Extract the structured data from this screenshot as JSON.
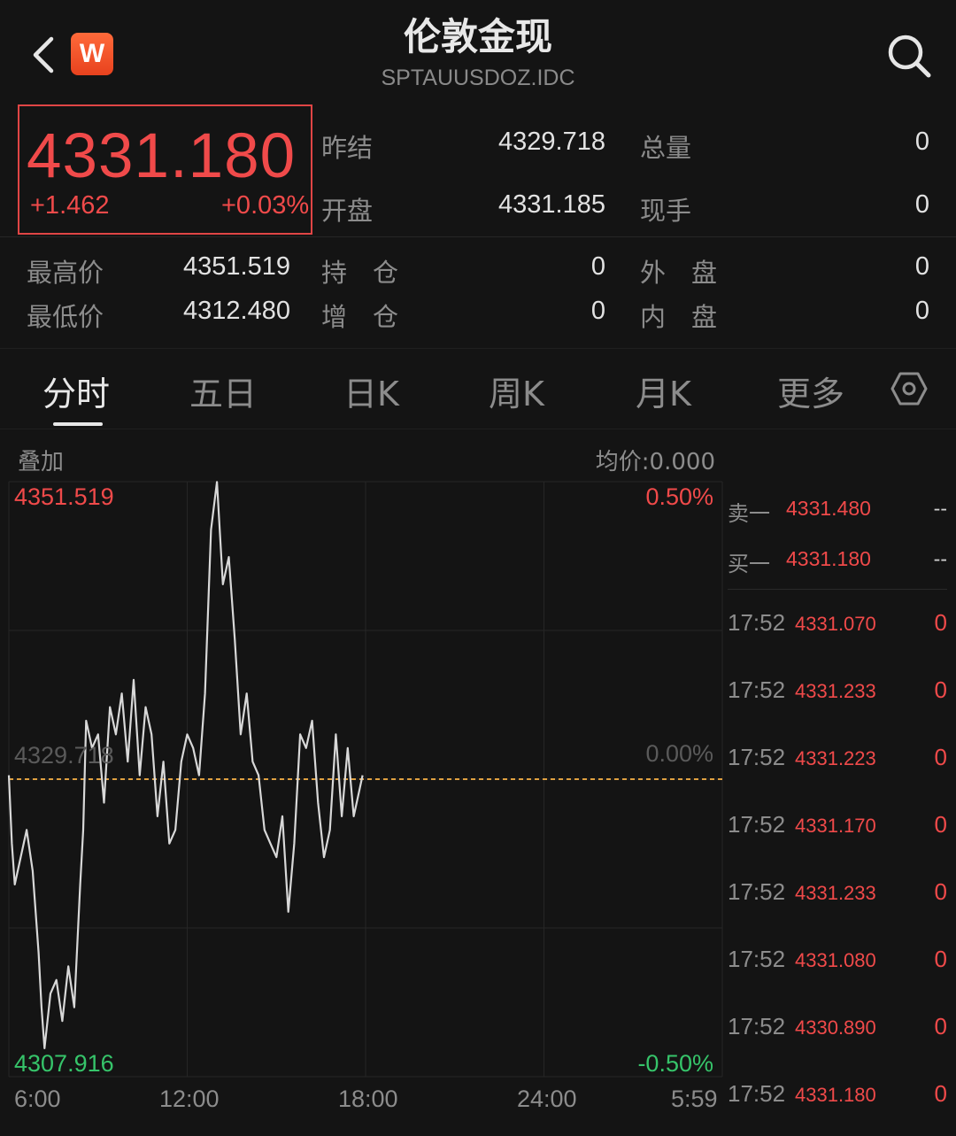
{
  "header": {
    "title": "伦敦金现",
    "symbol": "SPTAUUSDOZ.IDC",
    "logo_letter": "W",
    "back_icon": "back-arrow-icon",
    "search_icon": "search-icon"
  },
  "quote": {
    "last_price": "4331.180",
    "change": "+1.462",
    "change_pct": "+0.03%",
    "prev_settle_label": "昨结",
    "prev_settle": "4329.718",
    "open_label": "开盘",
    "open": "4331.185",
    "total_volume_label": "总量",
    "total_volume": "0",
    "current_hand_label": "现手",
    "current_hand": "0",
    "high_label": "最高价",
    "high": "4351.519",
    "low_label": "最低价",
    "low": "4312.480",
    "open_interest_label": "持　仓",
    "open_interest": "0",
    "oi_change_label": "增　仓",
    "oi_change": "0",
    "outer_label": "外　盘",
    "outer": "0",
    "inner_label": "内　盘",
    "inner": "0"
  },
  "tabs": [
    {
      "label": "分时",
      "active": true
    },
    {
      "label": "五日",
      "active": false
    },
    {
      "label": "日K",
      "active": false
    },
    {
      "label": "周K",
      "active": false
    },
    {
      "label": "月K",
      "active": false
    },
    {
      "label": "更多",
      "active": false
    }
  ],
  "chart_toolbar": {
    "overlay_label": "叠加",
    "avg_price_label": "均价:0.000"
  },
  "colors": {
    "up": "#f04a4a",
    "down": "#36c46a",
    "reference_line": "#e0a040",
    "price_line": "#d8d8d8",
    "background": "#141414"
  },
  "chart_data": {
    "type": "line",
    "title": "",
    "xlabel": "",
    "ylabel": "",
    "x_ticks": [
      "6:00",
      "12:00",
      "18:00",
      "24:00",
      "5:59"
    ],
    "x_range_hours": [
      6,
      30
    ],
    "ylim": [
      4307.916,
      4351.519
    ],
    "y_top_label": "4351.519",
    "y_bottom_label": "4307.916",
    "reference_value": 4329.718,
    "reference_label": "4329.718",
    "pct_top_label": "0.50%",
    "pct_mid_label": "0.00%",
    "pct_bottom_label": "-0.50%",
    "grid": true,
    "series": [
      {
        "x": [
          6.0,
          6.1,
          6.2,
          6.4,
          6.6,
          6.8,
          7.0,
          7.1,
          7.2,
          7.4,
          7.6,
          7.8,
          8.0,
          8.2,
          8.4,
          8.5,
          8.6,
          8.8,
          9.0,
          9.2,
          9.4,
          9.6,
          9.8,
          10.0,
          10.2,
          10.4,
          10.6,
          10.8,
          11.0,
          11.2,
          11.4,
          11.6,
          11.8,
          12.0,
          12.2,
          12.4,
          12.6,
          12.8,
          13.0,
          13.2,
          13.4,
          13.6,
          13.8,
          14.0,
          14.2,
          14.4,
          14.6,
          14.8,
          15.0,
          15.2,
          15.4,
          15.6,
          15.8,
          16.0,
          16.2,
          16.4,
          16.6,
          16.8,
          17.0,
          17.2,
          17.4,
          17.6,
          17.8,
          17.9
        ],
        "y": [
          4330,
          4325,
          4322,
          4324,
          4326,
          4323,
          4317,
          4313,
          4310,
          4314,
          4315,
          4312,
          4316,
          4313,
          4322,
          4326,
          4334,
          4332,
          4333,
          4328,
          4335,
          4333,
          4336,
          4331,
          4337,
          4330,
          4335,
          4333,
          4327,
          4331,
          4325,
          4326,
          4331,
          4333,
          4332,
          4330,
          4336,
          4348,
          4351.5,
          4344,
          4346,
          4340,
          4333,
          4336,
          4331,
          4330,
          4326,
          4325,
          4324,
          4327,
          4320,
          4325,
          4333,
          4332,
          4334,
          4328,
          4324,
          4326,
          4333,
          4327,
          4332,
          4327,
          4329,
          4330
        ]
      }
    ]
  },
  "order_book": [
    {
      "label": "卖一",
      "price": "4331.480",
      "volume": "--"
    },
    {
      "label": "买一",
      "price": "4331.180",
      "volume": "--"
    }
  ],
  "trades": [
    {
      "time": "17:52",
      "price": "4331.070",
      "volume": "0"
    },
    {
      "time": "17:52",
      "price": "4331.233",
      "volume": "0"
    },
    {
      "time": "17:52",
      "price": "4331.223",
      "volume": "0"
    },
    {
      "time": "17:52",
      "price": "4331.170",
      "volume": "0"
    },
    {
      "time": "17:52",
      "price": "4331.233",
      "volume": "0"
    },
    {
      "time": "17:52",
      "price": "4331.080",
      "volume": "0"
    },
    {
      "time": "17:52",
      "price": "4330.890",
      "volume": "0"
    },
    {
      "time": "17:52",
      "price": "4331.180",
      "volume": "0"
    }
  ]
}
